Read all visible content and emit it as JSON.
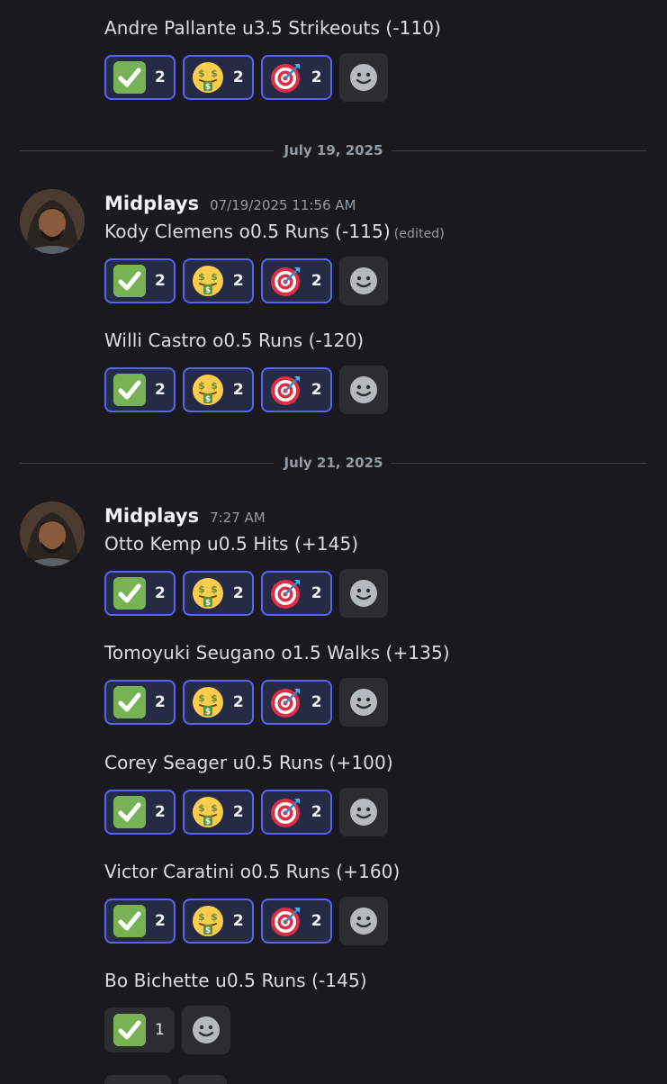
{
  "dividers": [
    "July 19, 2025",
    "July 21, 2025"
  ],
  "groups": [
    {
      "username": "Midplays",
      "timestamp": "07/19/2025 11:56 AM"
    },
    {
      "username": "Midplays",
      "timestamp": "7:27 AM"
    }
  ],
  "edited_label": "(edited)",
  "messages": [
    {
      "text": "Andre Pallante u3.5 Strikeouts (-110)",
      "reactions": [
        {
          "emoji": "check-mark-icon",
          "count": "2"
        },
        {
          "emoji": "money-mouth-face-icon",
          "count": "2"
        },
        {
          "emoji": "bullseye-icon",
          "count": "2"
        }
      ]
    },
    {
      "text": "Kody Clemens o0.5 Runs (-115)",
      "edited": true,
      "reactions": [
        {
          "emoji": "check-mark-icon",
          "count": "2"
        },
        {
          "emoji": "money-mouth-face-icon",
          "count": "2"
        },
        {
          "emoji": "bullseye-icon",
          "count": "2"
        }
      ]
    },
    {
      "text": "Willi Castro o0.5 Runs (-120)",
      "reactions": [
        {
          "emoji": "check-mark-icon",
          "count": "2"
        },
        {
          "emoji": "money-mouth-face-icon",
          "count": "2"
        },
        {
          "emoji": "bullseye-icon",
          "count": "2"
        }
      ]
    },
    {
      "text": "Otto Kemp u0.5 Hits (+145)",
      "reactions": [
        {
          "emoji": "check-mark-icon",
          "count": "2"
        },
        {
          "emoji": "money-mouth-face-icon",
          "count": "2"
        },
        {
          "emoji": "bullseye-icon",
          "count": "2"
        }
      ]
    },
    {
      "text": "Tomoyuki Seugano o1.5 Walks (+135)",
      "reactions": [
        {
          "emoji": "check-mark-icon",
          "count": "2"
        },
        {
          "emoji": "money-mouth-face-icon",
          "count": "2"
        },
        {
          "emoji": "bullseye-icon",
          "count": "2"
        }
      ]
    },
    {
      "text": "Corey Seager u0.5 Runs (+100)",
      "reactions": [
        {
          "emoji": "check-mark-icon",
          "count": "2"
        },
        {
          "emoji": "money-mouth-face-icon",
          "count": "2"
        },
        {
          "emoji": "bullseye-icon",
          "count": "2"
        }
      ]
    },
    {
      "text": "Victor Caratini o0.5 Runs (+160)",
      "reactions": [
        {
          "emoji": "check-mark-icon",
          "count": "2"
        },
        {
          "emoji": "money-mouth-face-icon",
          "count": "2"
        },
        {
          "emoji": "bullseye-icon",
          "count": "2"
        }
      ]
    },
    {
      "text": "Bo Bichette u0.5 Runs (-145)",
      "reactions": [
        {
          "emoji": "check-mark-icon",
          "count": "1"
        }
      ]
    }
  ],
  "colors": {
    "background": "#1a1a1e",
    "reacted_border": "#5865f2",
    "reacted_bg": "#252a45",
    "chip_bg": "#2b2d31",
    "muted": "#949ba4"
  }
}
